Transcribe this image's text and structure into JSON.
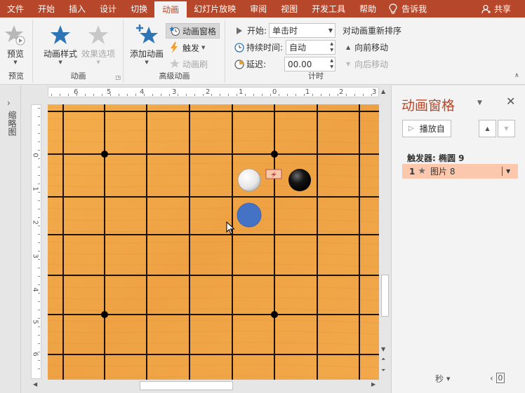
{
  "menu": {
    "tabs": [
      "文件",
      "开始",
      "插入",
      "设计",
      "切换",
      "动画",
      "幻灯片放映",
      "审阅",
      "视图",
      "开发工具",
      "帮助"
    ],
    "active_index": 5,
    "tell_me": "告诉我",
    "share": "共享",
    "tell_me_icon": "lightbulb-icon",
    "share_icon": "person-icon"
  },
  "ribbon": {
    "preview_group": {
      "label": "预览",
      "preview_button": "预览"
    },
    "animation_group": {
      "label": "动画",
      "styles_button": "动画样式",
      "effect_options_button": "效果选项"
    },
    "advanced_group": {
      "label": "高级动画",
      "add_animation_button": "添加动画",
      "animation_pane_button": "动画窗格",
      "trigger_button": "触发",
      "animation_painter_button": "动画刷"
    },
    "timing_group": {
      "label": "计时",
      "start_label": "开始:",
      "start_value": "单击时",
      "duration_label": "持续时间:",
      "duration_value": "自动",
      "delay_label": "延迟:",
      "delay_value": "00.00",
      "reorder_title": "对动画重新排序",
      "move_earlier": "向前移动",
      "move_later": "向后移动"
    }
  },
  "thumbnail_panel": {
    "label": "缩略图"
  },
  "rulers": {
    "horizontal": [
      "6",
      "5",
      "4",
      "3",
      "2",
      "1",
      "0",
      "1",
      "2",
      "3"
    ],
    "vertical": [
      "0",
      "1",
      "2",
      "3",
      "4",
      "5",
      "6"
    ]
  },
  "animation_pane": {
    "title": "动画窗格",
    "play_from": "播放自",
    "trigger_label": "触发器: 椭圆 9",
    "items": [
      {
        "number": "1",
        "name": "图片 8"
      }
    ],
    "time_unit": "秒",
    "page_value": "0"
  },
  "colors": {
    "accent": "#b7472a",
    "board": "#f0a646",
    "grid_line": "#1e140a",
    "blue_circle": "#4472c4",
    "selected_row": "#fbc8ae",
    "star_icon": "#2e75b6"
  }
}
